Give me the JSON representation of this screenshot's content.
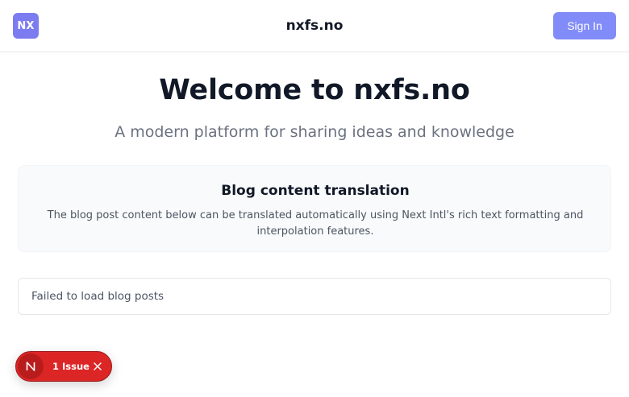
{
  "header": {
    "logo_text": "NX",
    "site_title": "nxfs.no",
    "signin_label": "Sign In",
    "logo_color": "#7c7cf0",
    "signin_color": "#818cf8"
  },
  "hero": {
    "title": "Welcome to nxfs.no",
    "subtitle": "A modern platform for sharing ideas and knowledge"
  },
  "info_card": {
    "title": "Blog content translation",
    "text": "The blog post content below can be translated automatically using Next Intl's rich text formatting and interpolation features."
  },
  "blog_posts": {
    "error_text": "Failed to load blog posts"
  },
  "dev_overlay": {
    "issue_label": "1 Issue",
    "badge_icon": "nextjs-logo-icon",
    "close_icon": "close-icon",
    "color": "#dc2626"
  }
}
